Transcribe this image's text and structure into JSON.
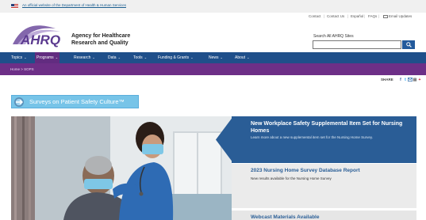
{
  "gov_banner": {
    "text": "An official website of the Department of Health & Human Services"
  },
  "utility": {
    "contact": "Contact",
    "contact_us": "Contact Us",
    "espanol": "Español",
    "faqs": "FAQs",
    "email_updates": "Email Updates"
  },
  "header": {
    "logo_text": "AHRQ",
    "agency_line1": "Agency for Healthcare",
    "agency_line2": "Research and Quality",
    "search_label": "Search All AHRQ Sites",
    "search_placeholder": ""
  },
  "nav": {
    "items": [
      {
        "label": "Topics"
      },
      {
        "label": "Programs"
      },
      {
        "label": "Research"
      },
      {
        "label": "Data"
      },
      {
        "label": "Tools"
      },
      {
        "label": "Funding & Grants"
      },
      {
        "label": "News"
      },
      {
        "label": "About"
      }
    ]
  },
  "breadcrumb": {
    "text": "Home > SOPS"
  },
  "share": {
    "label": "SHARE"
  },
  "page": {
    "title": "Surveys on Patient Safety Culture™"
  },
  "panels": {
    "feature_title": "New Workplace Safety Supplemental Item Set for Nursing Homes",
    "feature_desc": "Learn more about a new supplemental item set for the Nursing Home Survey.",
    "report_title": "2023 Nursing Home Survey Database Report",
    "report_desc": "New results available for the Nursing Home Survey",
    "webcast_title": "Webcast Materials Available"
  },
  "colors": {
    "nav_blue": "#1f4f8a",
    "purple": "#6d2f87",
    "feature_blue": "#2a5d96",
    "title_badge": "#77c4e8"
  }
}
